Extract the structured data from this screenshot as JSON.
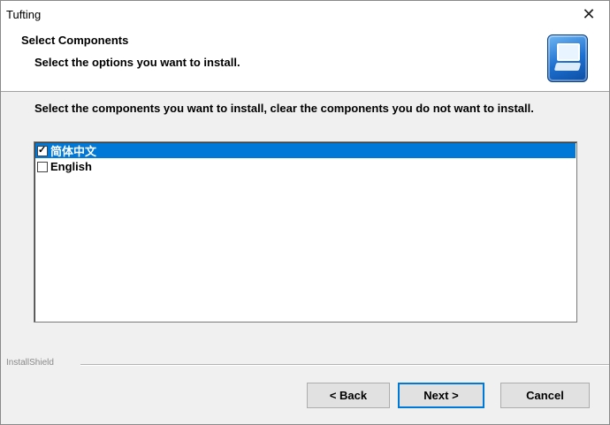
{
  "window": {
    "title": "Tufting",
    "close_glyph": "✕"
  },
  "header": {
    "title": "Select Components",
    "subtitle": "Select the options you want to install.",
    "icon": "installer-computer-icon"
  },
  "instruction": "Select the components you want to install, clear the components you do not want to install.",
  "components": [
    {
      "label": "简体中文",
      "checked": true,
      "selected": true
    },
    {
      "label": "English",
      "checked": false,
      "selected": false
    }
  ],
  "footer": {
    "brand": "InstallShield"
  },
  "buttons": {
    "back": "< Back",
    "next": "Next >",
    "cancel": "Cancel"
  },
  "colors": {
    "selection": "#0078d7",
    "default_button_border": "#0078d7"
  }
}
